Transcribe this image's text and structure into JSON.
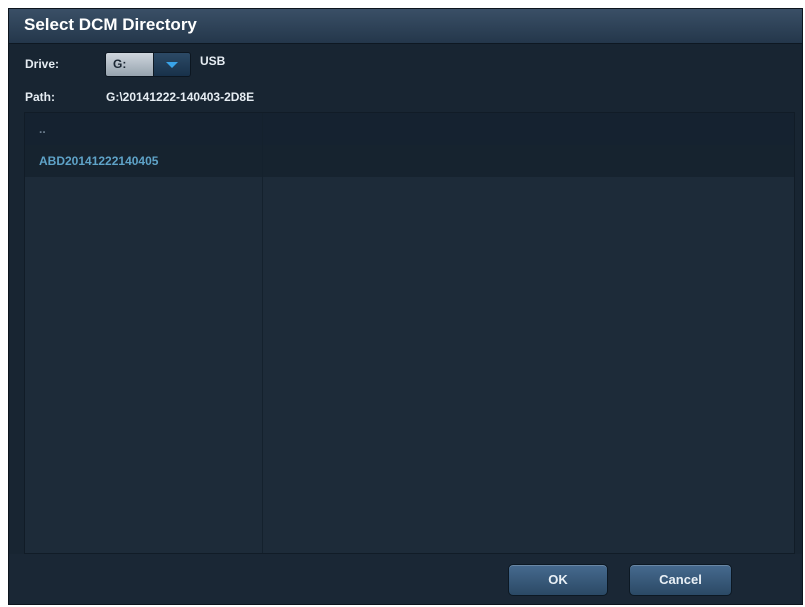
{
  "dialog": {
    "title": "Select DCM Directory"
  },
  "drive": {
    "label": "Drive:",
    "selected": "G:",
    "type": "USB"
  },
  "path": {
    "label": "Path:",
    "value": "G:\\20141222-140403-2D8E"
  },
  "list": {
    "items": [
      "..",
      "ABD20141222140405"
    ]
  },
  "buttons": {
    "ok": "OK",
    "cancel": "Cancel"
  },
  "colors": {
    "accent_text": "#5fa3c8",
    "background": "#182532"
  },
  "icons": {
    "dropdown": "chevron-down-icon"
  }
}
